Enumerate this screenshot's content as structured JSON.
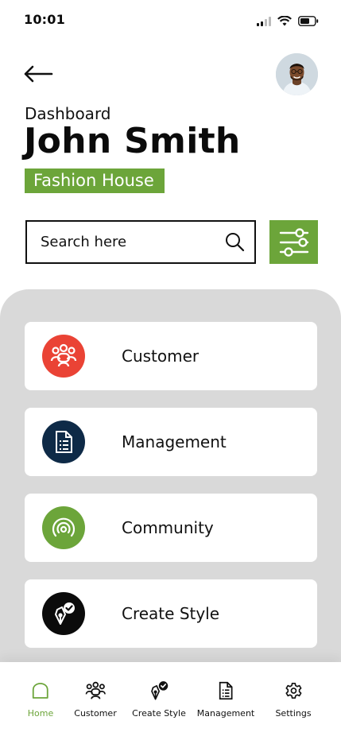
{
  "status_bar": {
    "time": "10:01"
  },
  "header": {
    "subtitle": "Dashboard",
    "title": "John Smith",
    "company_badge": "Fashion House"
  },
  "search": {
    "placeholder": "Search here"
  },
  "menu": [
    {
      "label": "Customer",
      "icon": "customers-icon",
      "color": "#ea4335"
    },
    {
      "label": "Management",
      "icon": "document-icon",
      "color": "#0e2a47"
    },
    {
      "label": "Community",
      "icon": "broadcast-icon",
      "color": "#6ca53a"
    },
    {
      "label": "Create Style",
      "icon": "pen-nib-check-icon",
      "color": "#0b0b0b"
    }
  ],
  "bottom_nav": [
    {
      "label": "Home",
      "icon": "home-icon",
      "active": true
    },
    {
      "label": "Customer",
      "icon": "customers-icon",
      "active": false
    },
    {
      "label": "Create Style",
      "icon": "pen-nib-check-icon",
      "active": false
    },
    {
      "label": "Management",
      "icon": "document-icon",
      "active": false
    },
    {
      "label": "Settings",
      "icon": "gear-icon",
      "active": false
    }
  ],
  "colors": {
    "accent": "#6ca53a",
    "panel": "#d9d9d9"
  }
}
